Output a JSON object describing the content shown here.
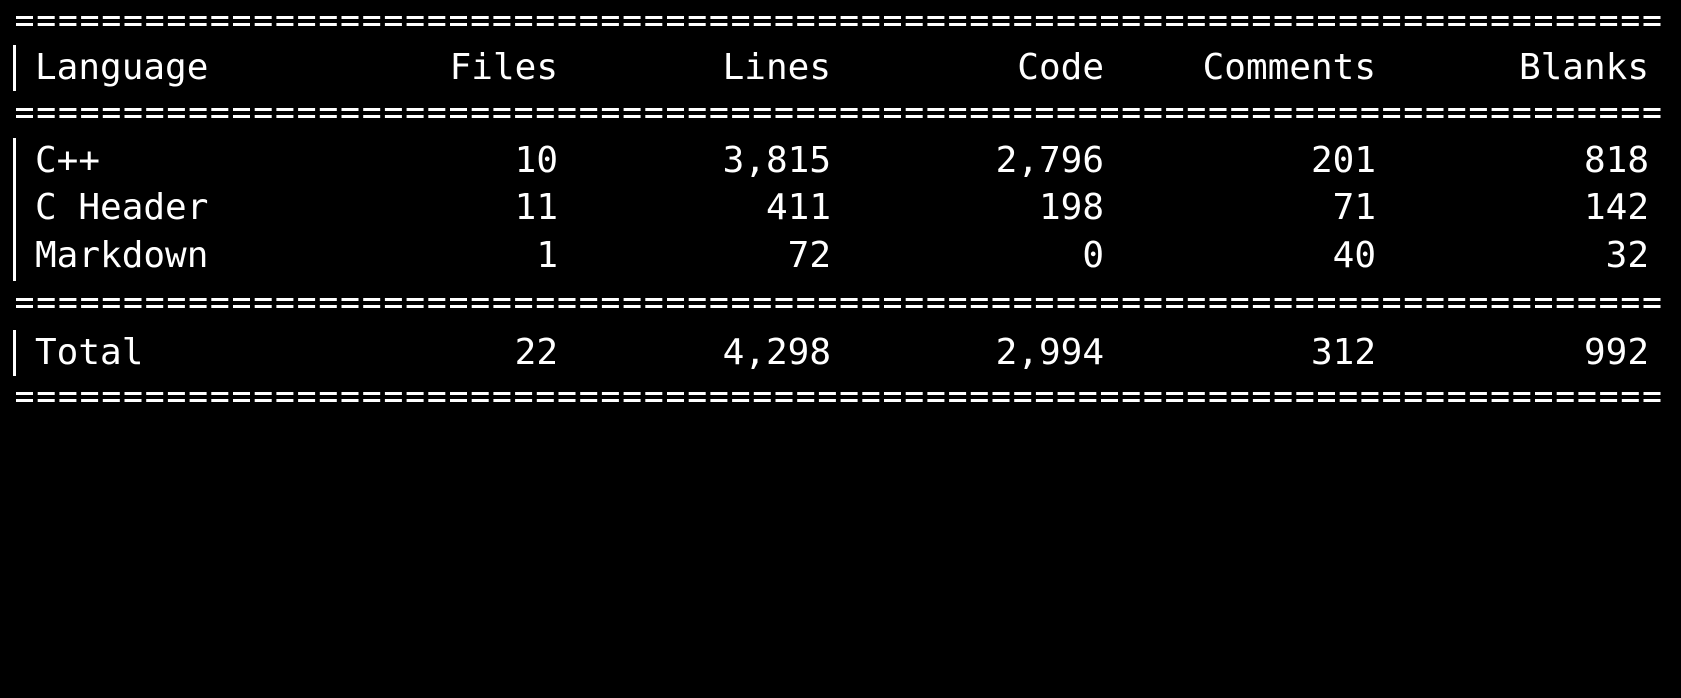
{
  "table": {
    "columns": [
      "Language",
      "Files",
      "Lines",
      "Code",
      "Comments",
      "Blanks"
    ],
    "rows": [
      [
        "C++",
        "10",
        "3,815",
        "2,796",
        "201",
        "818"
      ],
      [
        "C Header",
        "11",
        "411",
        "198",
        "71",
        "142"
      ],
      [
        "Markdown",
        "1",
        "72",
        "0",
        "40",
        "32"
      ]
    ],
    "total": [
      "Total",
      "22",
      "4,298",
      "2,994",
      "312",
      "992"
    ]
  },
  "colors": {
    "background": "#000000",
    "foreground": "#ffffff"
  }
}
